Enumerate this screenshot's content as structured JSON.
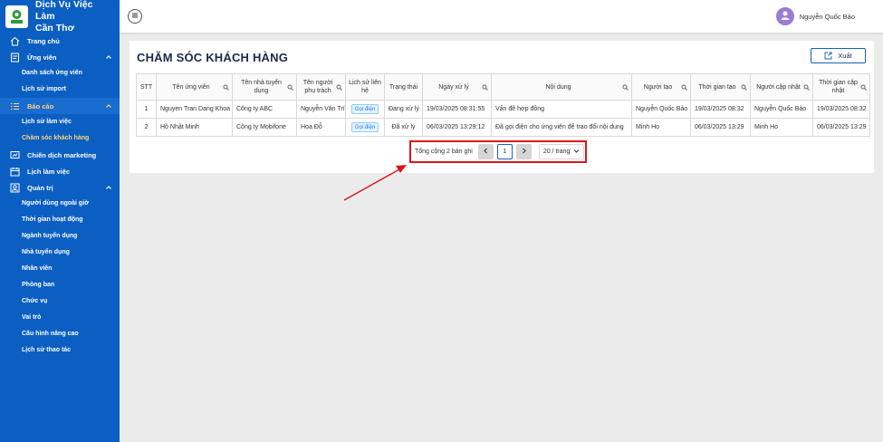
{
  "app": {
    "brand_line1": "Dịch Vụ Việc Làm",
    "brand_line2": "Cần Thơ",
    "user_name": "Nguyễn Quốc Bảo"
  },
  "sidebar": {
    "home": "Trang chủ",
    "candidates": {
      "label": "Ứng viên",
      "items": [
        "Danh sách ứng viên",
        "Lịch sử import"
      ]
    },
    "reports": {
      "label": "Báo cáo",
      "items": [
        "Lịch sử làm việc",
        "Chăm sóc khách hàng"
      ]
    },
    "marketing": "Chiến dịch marketing",
    "schedule": "Lịch làm việc",
    "admin": {
      "label": "Quản trị",
      "items": [
        "Người dùng ngoài giờ",
        "Thời gian hoạt động",
        "Ngành tuyển dụng",
        "Nhà tuyển dụng",
        "Nhân viên",
        "Phòng ban",
        "Chức vụ",
        "Vai trò",
        "Cấu hình nâng cao",
        "Lịch sử thao tác"
      ]
    }
  },
  "page": {
    "title": "CHĂM SÓC KHÁCH HÀNG",
    "export_label": "Xuất"
  },
  "table": {
    "headers": [
      "STT",
      "Tên ứng viên",
      "Tên nhà tuyển dụng",
      "Tên người phụ trách",
      "Lịch sử liên hệ",
      "Trạng thái",
      "Ngày xử lý",
      "Nội dung",
      "Người tạo",
      "Thời gian tạo",
      "Người cập nhật",
      "Thời gian cập nhật"
    ],
    "rows": [
      [
        "1",
        "Nguyen Tran Dang Khoa",
        "Công ty ABC",
        "Nguyễn Văn Trí",
        "Gọi điện",
        "Đang xử lý",
        "19/03/2025 08:31:55",
        "Vấn đề hợp đồng",
        "Nguyễn Quốc Bảo",
        "19/03/2025 08:32",
        "Nguyễn Quốc Bảo",
        "19/03/2025 08:32"
      ],
      [
        "2",
        "Hồ Nhật Minh",
        "Công ty Mobifone",
        "Hoa Đỗ",
        "Gọi điện",
        "Đã xử lý",
        "06/03/2025 13:29:12",
        "Đã gọi điện cho ứng viên để trao đổi nội dung",
        "Minh Ho",
        "06/03/2025 13:29",
        "Minh Ho",
        "06/03/2025 13:29"
      ]
    ]
  },
  "pagination": {
    "total_text": "Tổng cộng 2 bản ghi",
    "current_page": "1",
    "page_size": "20 / trang"
  },
  "colors": {
    "sidebar": "#0b5fc2",
    "active_menu": "#ffd27a",
    "annotation": "#d9161c"
  }
}
